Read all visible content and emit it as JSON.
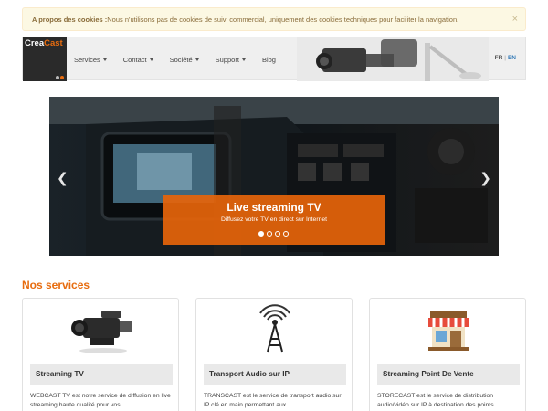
{
  "cookie": {
    "label": "A propos des cookies :",
    "text": " Nous n'utilisons pas de cookies de suivi commercial, uniquement des cookies techniques pour faciliter la navigation.",
    "close": "×"
  },
  "logo": {
    "part1": "Crea",
    "part2": "Cast"
  },
  "nav": {
    "items": [
      "Services",
      "Contact",
      "Société",
      "Support",
      "Blog"
    ]
  },
  "lang": {
    "fr": "FR",
    "sep": "|",
    "en": "EN"
  },
  "carousel": {
    "title": "Live streaming TV",
    "subtitle": "Diffusez votre TV en direct sur Internet",
    "prev": "❮",
    "next": "❯",
    "slides_total": 4,
    "active_slide": 1
  },
  "services": {
    "title": "Nos services",
    "cards": [
      {
        "title": "Streaming TV",
        "desc": "WEBCAST TV est notre service de diffusion en live streaming haute qualité pour vos",
        "icon": "video-camera-icon"
      },
      {
        "title": "Transport Audio sur IP",
        "desc": "TRANSCAST est le service de transport audio sur IP clé en main permettant aux",
        "icon": "radio-tower-icon"
      },
      {
        "title": "Streaming Point De Vente",
        "desc": "STORECAST est le service de distribution audio/vidéo sur IP à destination des points",
        "icon": "store-icon"
      }
    ]
  },
  "colors": {
    "accent": "#e76c0f",
    "link": "#337ab7"
  }
}
